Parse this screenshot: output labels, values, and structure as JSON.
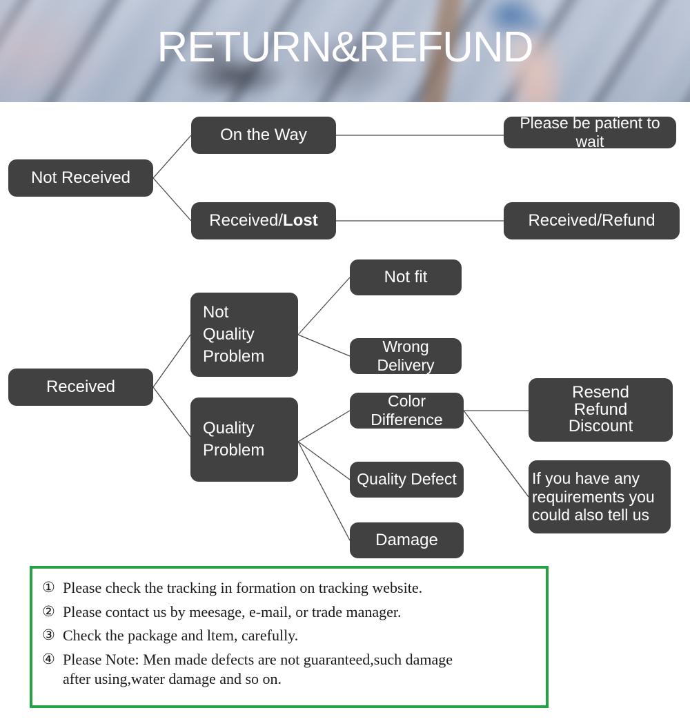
{
  "banner": {
    "title": "RETURN&REFUND"
  },
  "flowchart": {
    "nodes": [
      {
        "id": "not-received",
        "label": "Not Received"
      },
      {
        "id": "on-the-way",
        "label": "On the Way"
      },
      {
        "id": "received-lost",
        "label": "Received/",
        "label_bold": "Lost"
      },
      {
        "id": "please-be-patient",
        "label": "Please be patient to wait"
      },
      {
        "id": "received-refund",
        "label": "Received/Refund"
      },
      {
        "id": "received",
        "label": "Received"
      },
      {
        "id": "not-quality-problem",
        "label": "Not\nQuality\nProblem"
      },
      {
        "id": "quality-problem",
        "label": "Quality\nProblem"
      },
      {
        "id": "not-fit",
        "label": "Not fit"
      },
      {
        "id": "wrong-delivery",
        "label": "Wrong Delivery"
      },
      {
        "id": "color-difference",
        "label": "Color Difference"
      },
      {
        "id": "quality-defect",
        "label": "Quality Defect"
      },
      {
        "id": "damage",
        "label": "Damage"
      },
      {
        "id": "resend-refund-discount",
        "label": "Resend\nRefund\nDiscount"
      },
      {
        "id": "any-requirements",
        "label": "If you have any\nrequirements you\ncould also tell us"
      }
    ],
    "node_labels": {
      "not_received": "Not Received",
      "on_the_way": "On the Way",
      "received_lost_prefix": "Received/",
      "received_lost_bold": "Lost",
      "please_be_patient": "Please be patient to wait",
      "received_refund": "Received/Refund",
      "received": "Received",
      "not_quality_problem_l1": "Not",
      "not_quality_problem_l2": "Quality",
      "not_quality_problem_l3": "Problem",
      "quality_problem_l1": "Quality",
      "quality_problem_l2": "Problem",
      "not_fit": "Not fit",
      "wrong_delivery": "Wrong Delivery",
      "color_difference": "Color Difference",
      "quality_defect": "Quality Defect",
      "damage": "Damage",
      "resend_l1": "Resend",
      "resend_l2": "Refund",
      "resend_l3": "Discount",
      "requirements_l1": "If you have any",
      "requirements_l2": "requirements you",
      "requirements_l3": "could also tell us"
    }
  },
  "notes": {
    "items": [
      {
        "num": "①",
        "text": "Please check the tracking in formation on tracking website."
      },
      {
        "num": "②",
        "text": "Please contact us by meesage, e-mail, or trade manager."
      },
      {
        "num": "③",
        "text": "Check the package and ltem, carefully."
      },
      {
        "num": "④",
        "text": "Please Note: Men made defects  are not guaranteed,such damage"
      }
    ],
    "continuation": "after using,water damage and so on."
  },
  "colors": {
    "node_fill": "#414141",
    "node_text": "#ffffff",
    "line": "#4a4a4a",
    "notes_border": "#25a244",
    "notes_text": "#1a1a1a",
    "banner_title": "#ffffff"
  }
}
